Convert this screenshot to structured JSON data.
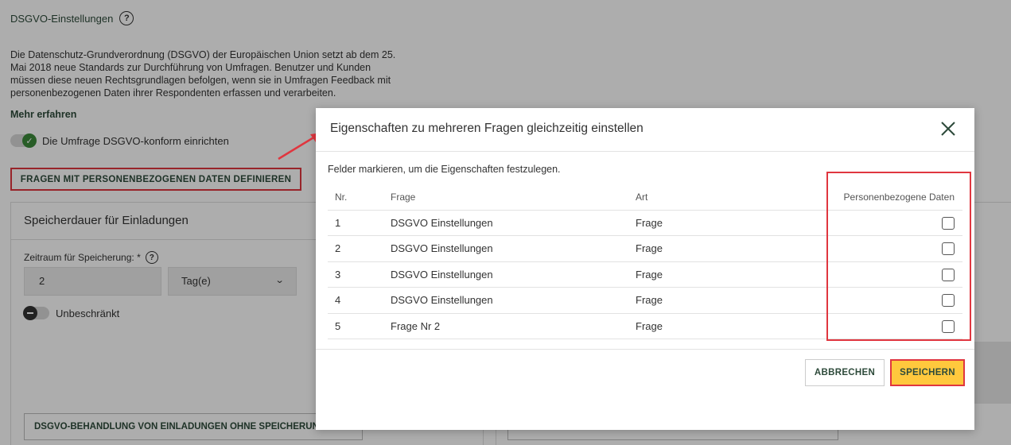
{
  "background": {
    "page_title": "DSGVO-Einstellungen",
    "intro": "Die Datenschutz-Grundverordnung (DSGVO) der Europäischen Union setzt ab dem 25. Mai 2018 neue Standards zur Durchführung von Umfragen. Benutzer und Kunden müssen diese neuen Rechtsgrundlagen befolgen, wenn sie in Umfragen Feedback mit personenbezogenen Daten ihrer Respondenten erfassen und verarbeiten.",
    "more_link": "Mehr erfahren",
    "gdpr_toggle_label": "Die Umfrage DSGVO-konform einrichten",
    "define_button": "FRAGEN MIT PERSONENBEZOGENEN DATEN DEFINIEREN",
    "storage_panel": {
      "title": "Speicherdauer für Einladungen",
      "period_label": "Zeitraum für Speicherung: *",
      "period_value": "2",
      "unit_value": "Tag(e)",
      "unlimited_label": "Unbeschränkt",
      "bottom_button": "DSGVO-BEHANDLUNG VON EINLADUNGEN OHNE SPEICHERUNG"
    }
  },
  "modal": {
    "title": "Eigenschaften zu mehreren Fragen gleichzeitig einstellen",
    "hint": "Felder markieren, um die Eigenschaften festzulegen.",
    "columns": {
      "nr": "Nr.",
      "question": "Frage",
      "type": "Art",
      "personal_data": "Personenbezogene Daten"
    },
    "rows": [
      {
        "nr": "1",
        "question": "DSGVO Einstellungen",
        "type": "Frage"
      },
      {
        "nr": "2",
        "question": "DSGVO Einstellungen",
        "type": "Frage"
      },
      {
        "nr": "3",
        "question": "DSGVO Einstellungen",
        "type": "Frage"
      },
      {
        "nr": "4",
        "question": "DSGVO Einstellungen",
        "type": "Frage"
      },
      {
        "nr": "5",
        "question": "Frage Nr 2",
        "type": "Frage"
      }
    ],
    "cancel_label": "ABBRECHEN",
    "save_label": "SPEICHERN"
  },
  "colors": {
    "accent_green": "#2d4a3a",
    "toggle_on": "#3b8a3a",
    "highlight_red": "#e0363f",
    "save_yellow": "#ffc83d"
  },
  "icons": {
    "help": "question-circle-icon",
    "close": "close-x-icon",
    "dropdown": "chevron-down-icon",
    "toggle_on_check": "check-icon",
    "annotation": "red-arrow-icon"
  }
}
